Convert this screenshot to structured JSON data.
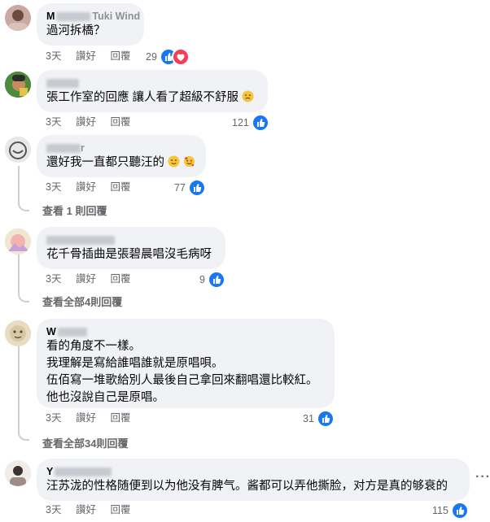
{
  "comments": [
    {
      "author": "M",
      "author_tail": "Tuki Wind",
      "lines": [
        "過河拆橋？"
      ],
      "time": "3天",
      "like_label": "讚好",
      "reply_label": "回覆",
      "reaction_count": "29",
      "reactions": [
        "like-icon",
        "love-icon"
      ]
    },
    {
      "author": "",
      "author_tail": "",
      "lines": [
        "張工作室的回應 讓人看了超級不舒服"
      ],
      "time": "3天",
      "like_label": "讚好",
      "reply_label": "回覆",
      "reaction_count": "121",
      "reactions": [
        "like-icon"
      ]
    },
    {
      "author": "",
      "author_tail": "r",
      "lines": [
        "還好我一直都只聽汪的"
      ],
      "time": "3天",
      "like_label": "讚好",
      "reply_label": "回覆",
      "reaction_count": "77",
      "reactions": [
        "like-icon"
      ],
      "view_replies": "查看 1 則回覆"
    },
    {
      "author": "",
      "author_tail": "",
      "lines": [
        "花千骨插曲是張碧晨唱沒毛病呀"
      ],
      "time": "3天",
      "like_label": "讚好",
      "reply_label": "回覆",
      "reaction_count": "9",
      "reactions": [
        "like-icon"
      ],
      "view_replies": "查看全部4則回覆"
    },
    {
      "author": "W",
      "author_tail": "",
      "lines": [
        "看的角度不一樣。",
        "我理解是寫給誰唱誰就是原唱唄。",
        "伍佰寫一堆歌給別人最後自己拿回來翻唱還比較紅。",
        "他也沒說自己是原唱。"
      ],
      "time": "3天",
      "like_label": "讚好",
      "reply_label": "回覆",
      "reaction_count": "31",
      "reactions": [
        "like-icon"
      ],
      "view_replies": "查看全部34則回覆"
    },
    {
      "author": "Y",
      "author_tail": "",
      "lines": [
        "汪苏泷的性格随便到以为他没有脾气。酱都可以弄他撕脸，对方是真的够衰的"
      ],
      "time": "3天",
      "like_label": "讚好",
      "reply_label": "回覆",
      "reaction_count": "115",
      "reactions": [
        "like-icon"
      ]
    }
  ],
  "more_options": "···",
  "colors": {
    "bubble": "#f0f2f5",
    "secondary_text": "#65676b",
    "like_blue": "#1877f2",
    "love_red": "#f33e58"
  }
}
